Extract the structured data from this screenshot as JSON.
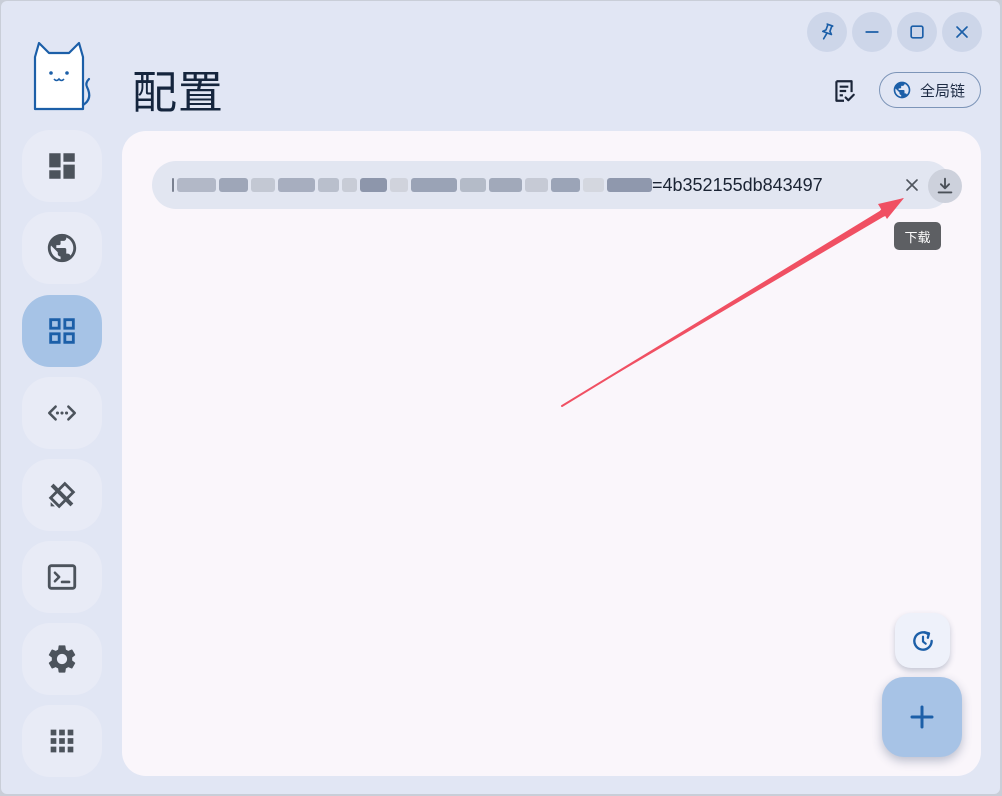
{
  "page": {
    "title": "配置"
  },
  "header": {
    "mode_label": "全局链",
    "notes_icon": "note-check-icon",
    "mode_icon": "globe-icon"
  },
  "window_controls": [
    "pin-icon",
    "minimize-icon",
    "maximize-icon",
    "close-icon"
  ],
  "sidebar": {
    "items": [
      {
        "name": "dashboard",
        "icon": "dashboard-icon",
        "active": false
      },
      {
        "name": "proxies",
        "icon": "globe-icon",
        "active": false
      },
      {
        "name": "profiles",
        "icon": "grid-icon",
        "active": true
      },
      {
        "name": "connections",
        "icon": "code-dots-icon",
        "active": false
      },
      {
        "name": "rules",
        "icon": "tools-icon",
        "active": false
      },
      {
        "name": "logs",
        "icon": "terminal-icon",
        "active": false
      },
      {
        "name": "settings",
        "icon": "gear-icon",
        "active": false
      },
      {
        "name": "more",
        "icon": "apps-icon",
        "active": false
      }
    ]
  },
  "profile_input": {
    "url_tail": "=4b352155db843497",
    "clear_icon": "close-icon",
    "download_icon": "download-icon",
    "download_tooltip": "下载"
  },
  "colors": {
    "accent": "#1c5fa8",
    "active_nav": "#a6c3e6",
    "annotation_arrow": "#f05063"
  },
  "fab": {
    "update_icon": "history-update-icon",
    "add_icon": "plus-icon"
  }
}
